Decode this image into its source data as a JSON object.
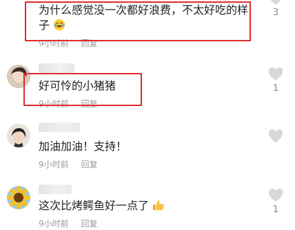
{
  "comments": [
    {
      "text_line1": "为什么感觉没一次都好浪费，不太好吃的样",
      "text_line2": "子",
      "time": "9小时前",
      "reply": "回复",
      "likes": "3"
    },
    {
      "text": "好可怜的小猪猪",
      "time": "9小时前",
      "reply": "回复",
      "likes": "1"
    },
    {
      "text": "加油加油！支持！",
      "time": "9小时前",
      "reply": "回复",
      "likes": ""
    },
    {
      "text": "这次比烤鳄鱼好一点了",
      "time": "9小时前",
      "reply": "回复",
      "likes": "1"
    }
  ],
  "icons": {
    "like": "heart-icon",
    "emoji_laugh": "laughing-face-emoji",
    "emoji_thumbs": "thumbs-up-emoji"
  },
  "colors": {
    "highlight_box": "#e02a2a",
    "meta_text": "#999999",
    "heart": "#d8d8d8"
  }
}
